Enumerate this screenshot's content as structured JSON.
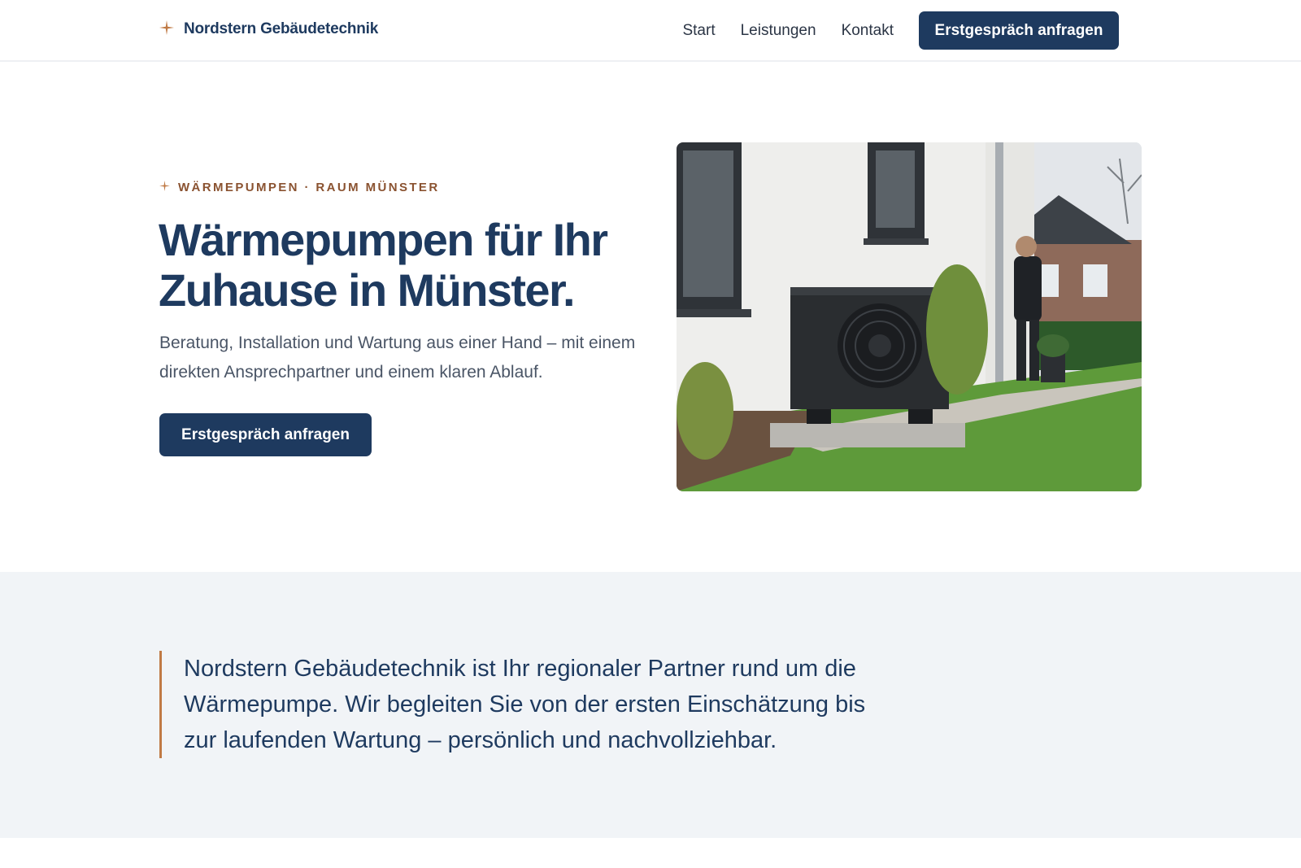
{
  "header": {
    "brand_icon": "star-sparkle-icon",
    "brand_name": "Nordstern Gebäudetechnik",
    "nav": [
      {
        "label": "Start"
      },
      {
        "label": "Leistungen"
      },
      {
        "label": "Kontakt"
      }
    ],
    "cta_label": "Erstgespräch anfragen"
  },
  "hero": {
    "eyebrow_icon": "star-sparkle-icon",
    "eyebrow": "WÄRMEPUMPEN · RAUM MÜNSTER",
    "title": "Wärmepumpen für Ihr Zuhause in Münster.",
    "subtitle": "Beratung, Installation und Wartung aus einer Hand – mit einem direkten Ansprechpartner und einem klaren Ablauf.",
    "cta_label": "Erstgespräch anfragen"
  },
  "intro": {
    "text": "Nordstern Gebäudetechnik ist Ihr regionaler Partner rund um die Wärmepumpe. Wir begleiten Sie von der ersten Einschätzung bis zur laufenden Wartung – persönlich und nachvollziehbar."
  },
  "colors": {
    "primary": "#1e3a5f",
    "accent": "#c07a45",
    "band_bg": "#f1f4f7"
  }
}
